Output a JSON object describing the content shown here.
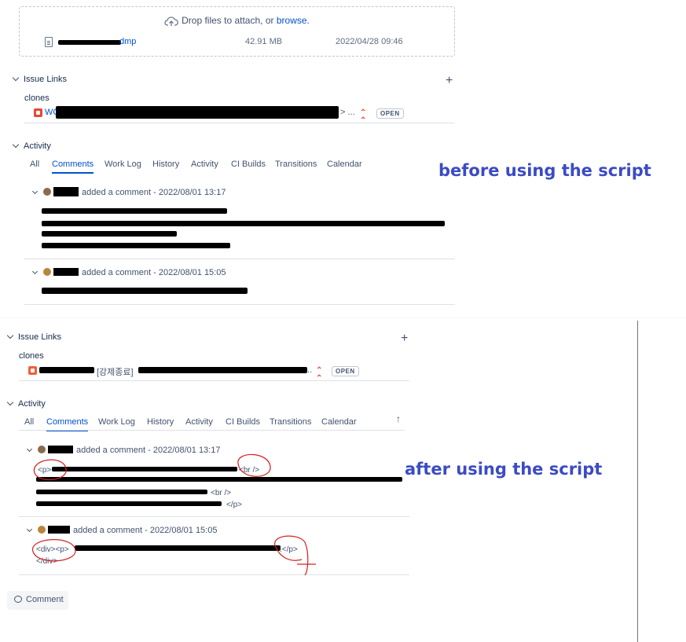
{
  "attachment": {
    "dropzone_text": "Drop files to attach, or ",
    "browse_link": "browse.",
    "file_name_suffix": "dmp",
    "file_size": "42.91 MB",
    "file_date": "2022/04/28 09:46"
  },
  "before": {
    "issue_links_title": "Issue Links",
    "clones_label": "clones",
    "link_prefix": "WC",
    "link_suffix": "> ...",
    "status_label": "OPEN",
    "activity_title": "Activity",
    "tabs": [
      "All",
      "Comments",
      "Work Log",
      "History",
      "Activity",
      "CI Builds",
      "Transitions",
      "Calendar"
    ],
    "comments": [
      {
        "action": "added a comment - 2022/08/01 13:17"
      },
      {
        "action": "added a comment - 2022/08/01 15:05"
      }
    ]
  },
  "after": {
    "issue_links_title": "Issue Links",
    "clones_label": "clones",
    "link_text": "[강제종료]",
    "link_suffix": "...",
    "status_label": "OPEN",
    "activity_title": "Activity",
    "tabs": [
      "All",
      "Comments",
      "Work Log",
      "History",
      "Activity",
      "CI Builds",
      "Transitions",
      "Calendar"
    ],
    "comments": [
      {
        "action": "added a comment - 2022/08/01 13:17",
        "code_p_open": "<p>",
        "code_br1": "<br />",
        "code_br2": "<br />",
        "code_p_close": "</p>"
      },
      {
        "action": "added a comment - 2022/08/01 15:05",
        "code_div_p": "<div><p>",
        "code_p_close": ".</p>",
        "code_div_close": "</div>"
      }
    ]
  },
  "annotations": {
    "before": "before using the script",
    "after": "after using the script"
  },
  "comment_button": "Comment",
  "colors": {
    "link": "#0052cc",
    "annotation": "#3b4bc4",
    "bug": "#e5493a",
    "markup_circle": "#d62020"
  }
}
